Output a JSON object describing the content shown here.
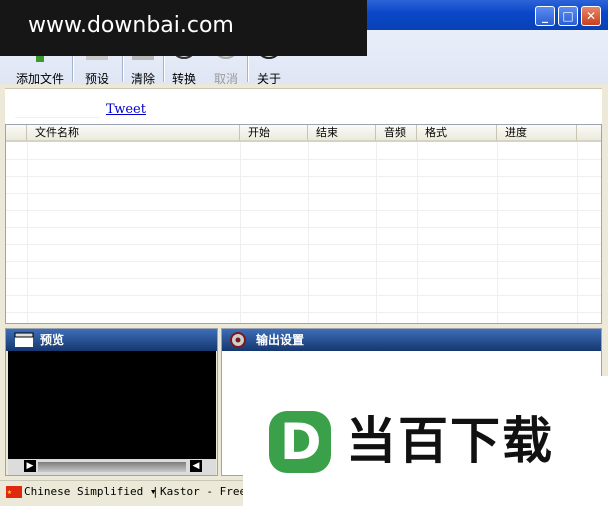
{
  "watermark": "www.downbai.com",
  "window": {
    "buttons": [
      "_",
      "□",
      "✕"
    ]
  },
  "toolbar": {
    "add_files": "添加文件",
    "preset": "预设",
    "clear": "清除",
    "convert": "转换",
    "cancel": "取消",
    "about": "关于"
  },
  "tweet": "Tweet",
  "list": {
    "columns": [
      "文件名称",
      "开始",
      "结束",
      "音频",
      "格式",
      "进度"
    ]
  },
  "preview": {
    "title": "预览"
  },
  "output": {
    "title": "输出设置"
  },
  "status": {
    "language": "Chinese Simplified",
    "info": "Kastor - Free"
  },
  "overlay_logo": {
    "letter": "D",
    "text": "当百下载"
  },
  "colors": {
    "titlebar": "#0a46c8",
    "panel_header": "#15376f",
    "logo_green": "#3aa14a"
  }
}
